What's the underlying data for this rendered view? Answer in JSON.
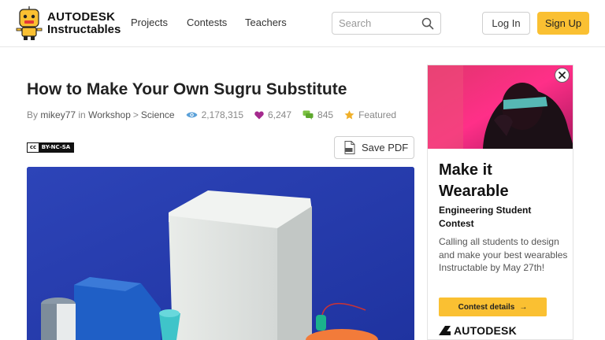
{
  "header": {
    "logo_line1": "AUTODESK",
    "logo_line2": "Instructables",
    "nav": [
      "Projects",
      "Contests",
      "Teachers"
    ],
    "search_placeholder": "Search",
    "login_label": "Log In",
    "signup_label": "Sign Up",
    "accent_color": "#fac032"
  },
  "article": {
    "title": "How to Make Your Own Sugru Substitute",
    "by_prefix": "By",
    "author": "mikey77",
    "in_word": "in",
    "category": "Workshop",
    "category_sep": ">",
    "subcategory": "Science",
    "views": "2,178,315",
    "favorites": "6,247",
    "comments": "845",
    "featured": "Featured",
    "license": "BY-NC-SA",
    "save_pdf_label": "Save PDF"
  },
  "ad": {
    "headline_line1": "Make it",
    "headline_line2": "Wearable",
    "subhead": "Engineering Student Contest",
    "body": "Calling all students to design and make your best wearables Instructable by May 27th!",
    "cta_label": "Contest details",
    "cta_arrow": "→",
    "brand": "AUTODESK"
  }
}
